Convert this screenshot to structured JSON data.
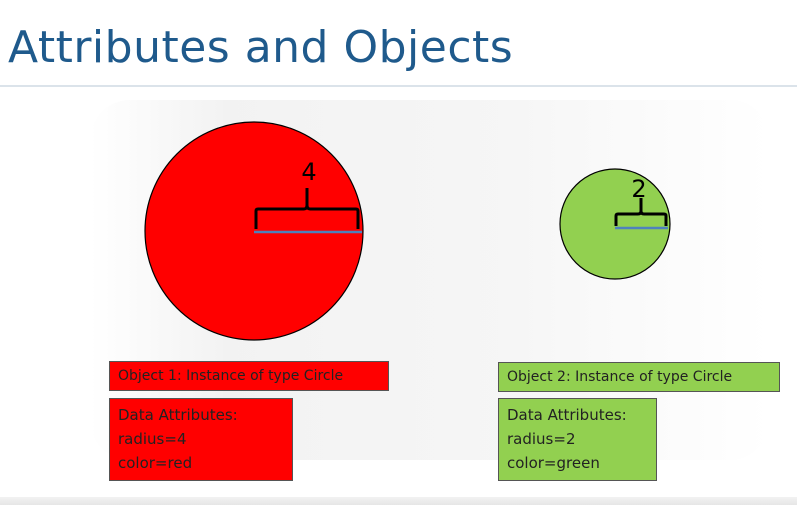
{
  "title": "Attributes and Objects",
  "object1": {
    "radius_label": "4",
    "label": "Object 1: Instance of type Circle",
    "attrs_header": "Data Attributes:",
    "attr_radius": "radius=4",
    "attr_color": "color=red",
    "fill": "#ff0000"
  },
  "object2": {
    "radius_label": "2",
    "label": "Object 2: Instance of type Circle",
    "attrs_header": "Data Attributes:",
    "attr_radius": "radius=2",
    "attr_color": "color=green",
    "fill": "#92d050"
  },
  "colors": {
    "title": "#1f5a8c",
    "radius_line": "#4f81bd",
    "outline": "#000000"
  }
}
